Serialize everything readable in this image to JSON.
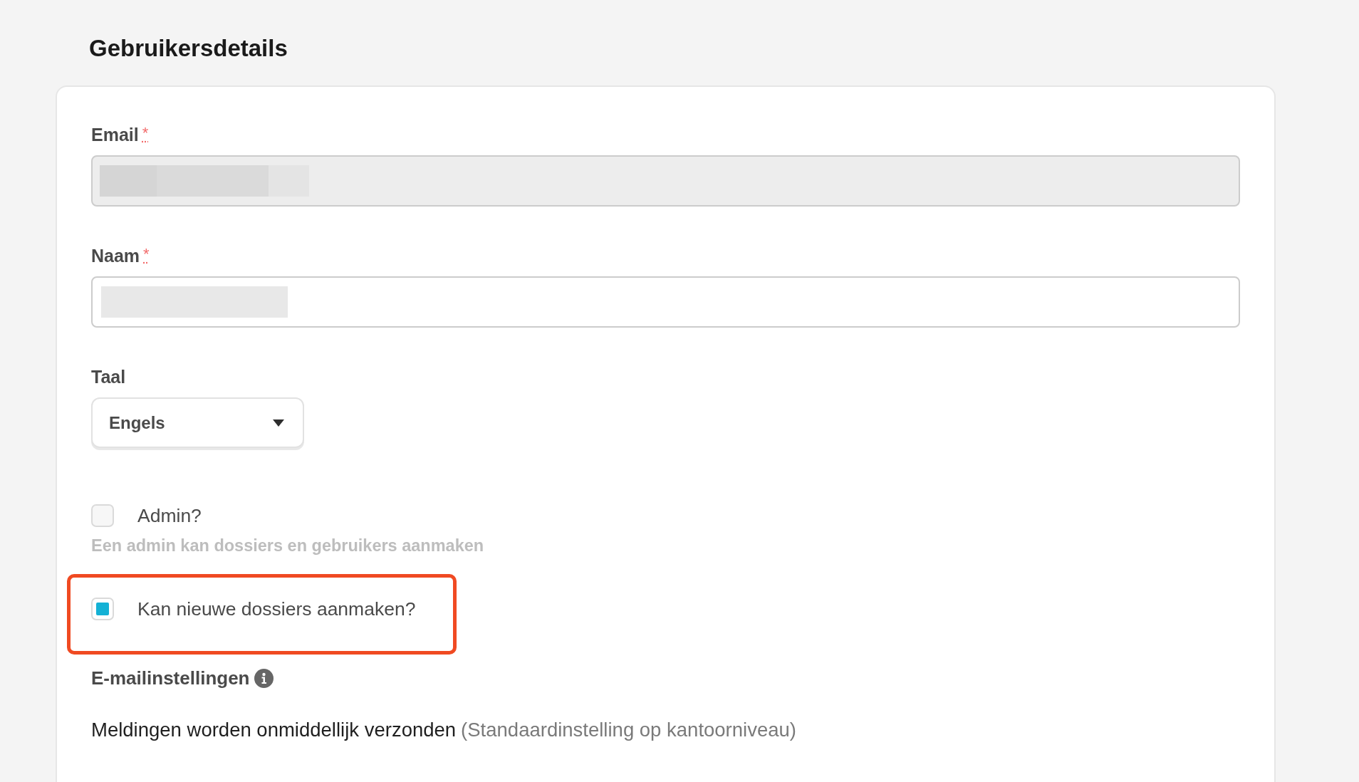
{
  "title": "Gebruikersdetails",
  "form": {
    "fields": [
      {
        "kind": "text",
        "label": "Email",
        "required_mark": "*",
        "disabled": true,
        "redacted": true
      },
      {
        "kind": "text",
        "label": "Naam",
        "required_mark": "*",
        "disabled": false,
        "redacted": true
      },
      {
        "kind": "select",
        "label": "Taal",
        "value": "Engels"
      }
    ],
    "checkboxes": [
      {
        "label": "Admin?",
        "checked": false,
        "highlighted": false,
        "hint": "Een admin kan dossiers en gebruikers aanmaken"
      },
      {
        "label": "Kan nieuwe dossiers aanmaken?",
        "checked": true,
        "highlighted": true
      }
    ],
    "email_settings": {
      "heading": "E-mailinstellingen",
      "value": "Meldingen worden onmiddellijk verzonden",
      "note": "(Standaardinstelling op kantoorniveau)"
    }
  }
}
